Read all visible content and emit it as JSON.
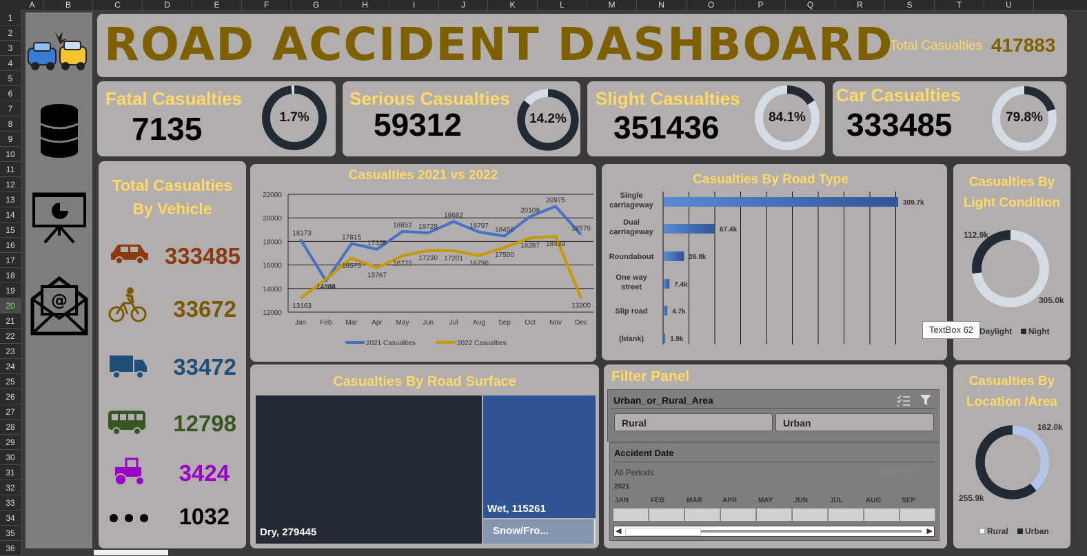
{
  "columns": [
    "A",
    "B",
    "C",
    "D",
    "E",
    "F",
    "G",
    "H",
    "I",
    "J",
    "K",
    "L",
    "M",
    "N",
    "O",
    "P",
    "Q",
    "R",
    "S",
    "T",
    "U"
  ],
  "rows": [
    "1",
    "2",
    "3",
    "4",
    "5",
    "6",
    "7",
    "8",
    "9",
    "10",
    "11",
    "12",
    "13",
    "14",
    "15",
    "16",
    "17",
    "18",
    "19",
    "20",
    "21",
    "22",
    "23",
    "24",
    "25",
    "26",
    "27",
    "28",
    "29",
    "30",
    "31",
    "32",
    "33",
    "34",
    "35",
    "36"
  ],
  "header": {
    "title": "ROAD ACCIDENT DASHBOARD",
    "total_label": "Total Casualties",
    "total_value": "417883"
  },
  "kpis": {
    "fatal": {
      "label": "Fatal Casualties",
      "value": "7135",
      "pct": "1.7%",
      "fraction": 0.017
    },
    "serious": {
      "label": "Serious Casualties",
      "value": "59312",
      "pct": "14.2%",
      "fraction": 0.142
    },
    "slight": {
      "label": "Slight Casualties",
      "value": "351436",
      "pct": "84.1%",
      "fraction": 0.841
    },
    "car": {
      "label": "Car Casualties",
      "value": "333485",
      "pct": "79.8%",
      "fraction": 0.798
    }
  },
  "vehicle": {
    "title_line1": "Total Casualties",
    "title_line2": "By Vehicle",
    "items": [
      {
        "icon": "car-icon",
        "value": "333485",
        "color": "#8b3a10"
      },
      {
        "icon": "bicycle-icon",
        "value": "33672",
        "color": "#7a5a00"
      },
      {
        "icon": "truck-icon",
        "value": "33472",
        "color": "#1f4e79"
      },
      {
        "icon": "bus-icon",
        "value": "12798",
        "color": "#375623"
      },
      {
        "icon": "tractor-icon",
        "value": "3424",
        "color": "#9b00c8"
      },
      {
        "icon": "more-icon",
        "value": "1032",
        "color": "#000000"
      }
    ]
  },
  "line_chart": {
    "title": "Casualties 2021 vs 2022",
    "legend_2021": "2021 Casualties",
    "legend_2022": "2022 Casualties",
    "yticks": [
      "22000",
      "20000",
      "18000",
      "16000",
      "14000",
      "12000"
    ]
  },
  "road_type": {
    "title": "Casualties By Road Type",
    "labels": [
      "Single carriageway",
      "Dual carriageway",
      "Roundabout",
      "One way street",
      "Slip road",
      "(blank)"
    ],
    "value_labels": [
      "309.7k",
      "67.4k",
      "26.8k",
      "7.4k",
      "4.7k",
      "1.9k"
    ],
    "values": [
      309.7,
      67.4,
      26.8,
      7.4,
      4.7,
      1.9
    ]
  },
  "light": {
    "title_line1": "Casualties By",
    "title_line2": "Light Condition",
    "night_label": "112.9k",
    "daylight_label": "305.0k",
    "legend_daylight": "Daylight",
    "legend_night": "Night",
    "tooltip": "TextBox 62",
    "night_fraction": 0.27
  },
  "surface": {
    "title": "Casualties By Road Surface",
    "dry": "Dry, 279445",
    "wet": "Wet, 115261",
    "snow": "Snow/Fro..."
  },
  "filter": {
    "title": "Filter Panel",
    "slicer_title": "Urban_or_Rural_Area",
    "options": [
      "Rural",
      "Urban"
    ],
    "timeline_title": "Accident Date",
    "all_periods": "All Periods",
    "period_unit": "MONTHS",
    "year": "2021",
    "months": [
      "JAN",
      "FEB",
      "MAR",
      "APR",
      "MAY",
      "JUN",
      "JUL",
      "AUG",
      "SEP"
    ]
  },
  "location": {
    "title_line1": "Casualties By",
    "title_line2": "Location /Area",
    "rural_label": "162.0k",
    "urban_label": "255.9k",
    "legend_rural": "Rural",
    "legend_urban": "Urban",
    "rural_fraction": 0.388
  },
  "chart_data": [
    {
      "type": "line",
      "title": "Casualties 2021 vs 2022",
      "x": [
        "Jan",
        "Feb",
        "Mar",
        "Apr",
        "May",
        "Jun",
        "Jul",
        "Aug",
        "Sep",
        "Oct",
        "Nov",
        "Dec"
      ],
      "series": [
        {
          "name": "2021 Casualties",
          "color": "#4472c4",
          "values": [
            18173,
            14648,
            17815,
            17335,
            18852,
            18728,
            19682,
            18797,
            18456,
            20109,
            20975,
            18576
          ]
        },
        {
          "name": "2022 Casualties",
          "color": "#c49a00",
          "values": [
            13163,
            14804,
            16575,
            15767,
            16775,
            17230,
            17201,
            16796,
            17500,
            18287,
            18439,
            13200
          ]
        }
      ],
      "ylim": [
        12000,
        22000
      ]
    },
    {
      "type": "bar",
      "title": "Casualties By Road Type",
      "categories": [
        "Single carriageway",
        "Dual carriageway",
        "Roundabout",
        "One way street",
        "Slip road",
        "(blank)"
      ],
      "values": [
        309.7,
        67.4,
        26.8,
        7.4,
        4.7,
        1.9
      ]
    }
  ],
  "colors": {
    "panel": "#b3aeae",
    "title": "#ffd966",
    "header_title": "#7f6000",
    "ring_dark": "#222a35",
    "ring_light": "#d6dce5"
  }
}
